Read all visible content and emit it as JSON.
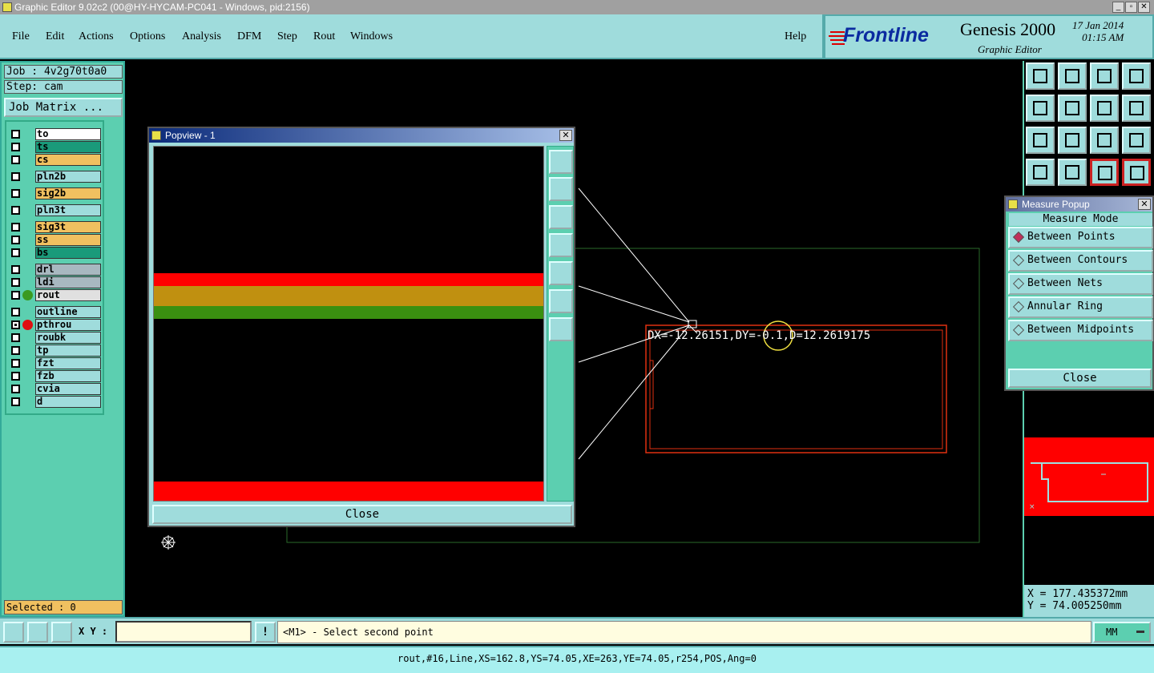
{
  "window": {
    "title": "Graphic Editor 9.02c2 (00@HY-HYCAM-PC041 - Windows, pid:2156)"
  },
  "menu": {
    "items": [
      "File",
      "Edit",
      "Actions",
      "Options",
      "Analysis",
      "DFM",
      "Step",
      "Rout",
      "Windows"
    ],
    "help": "Help"
  },
  "brand": {
    "logo": "Frontline",
    "product": "Genesis 2000",
    "subtitle": "Graphic Editor",
    "date": "17 Jan 2014",
    "time": "01:15 AM"
  },
  "job": {
    "job_label": "Job : 4v2g70t0a0",
    "step_label": "Step: cam",
    "matrix_button": "Job Matrix ..."
  },
  "layers": [
    {
      "name": "to",
      "color": "#ffffff",
      "on": false
    },
    {
      "name": "ts",
      "color": "#1a9a7a",
      "on": false
    },
    {
      "name": "cs",
      "color": "#f0c060",
      "on": false
    },
    {
      "name": "pln2b",
      "color": "#9fdcdc",
      "on": false
    },
    {
      "name": "sig2b",
      "color": "#f0c060",
      "on": false
    },
    {
      "name": "pln3t",
      "color": "#9fdcdc",
      "on": false
    },
    {
      "name": "sig3t",
      "color": "#f0c060",
      "on": false
    },
    {
      "name": "ss",
      "color": "#f0c060",
      "on": false
    },
    {
      "name": "bs",
      "color": "#1a9a7a",
      "on": false
    },
    {
      "name": "drl",
      "color": "#a8b8c0",
      "on": false
    },
    {
      "name": "ldi",
      "color": "#a8b8c0",
      "on": false
    },
    {
      "name": "rout",
      "color": "#e0e0e0",
      "on": false,
      "lamp": "#3a9a20"
    },
    {
      "name": "outline",
      "color": "#9fdcdc",
      "on": false
    },
    {
      "name": "pthrou",
      "color": "#9fdcdc",
      "on": true,
      "lamp": "#e01010"
    },
    {
      "name": "roubk",
      "color": "#9fdcdc",
      "on": false
    },
    {
      "name": "tp",
      "color": "#9fdcdc",
      "on": false
    },
    {
      "name": "fzt",
      "color": "#9fdcdc",
      "on": false
    },
    {
      "name": "fzb",
      "color": "#9fdcdc",
      "on": false
    },
    {
      "name": "cvia",
      "color": "#9fdcdc",
      "on": false
    },
    {
      "name": "d",
      "color": "#9fdcdc",
      "on": false
    }
  ],
  "selected": "Selected : 0",
  "popview": {
    "title": "Popview - 1",
    "close": "Close"
  },
  "measure": {
    "title": "Measure Popup",
    "mode": "Measure Mode",
    "options": [
      "Between Points",
      "Between Contours",
      "Between Nets",
      "Annular Ring",
      "Between Midpoints"
    ],
    "selected_index": 0,
    "close": "Close"
  },
  "canvas": {
    "measure_text": "DX=-12.26151,DY=-0.1,D=12.2619175"
  },
  "coords": {
    "x": "X = 177.435372mm",
    "y": "Y = 74.005250mm"
  },
  "bottom": {
    "xy_label": "X Y :",
    "xy_value": "",
    "prompt": "<M1> - Select second point",
    "units": "MM"
  },
  "status": "rout,#16,Line,XS=162.8,YS=74.05,XE=263,YE=74.05,r254,POS,Ang=0"
}
